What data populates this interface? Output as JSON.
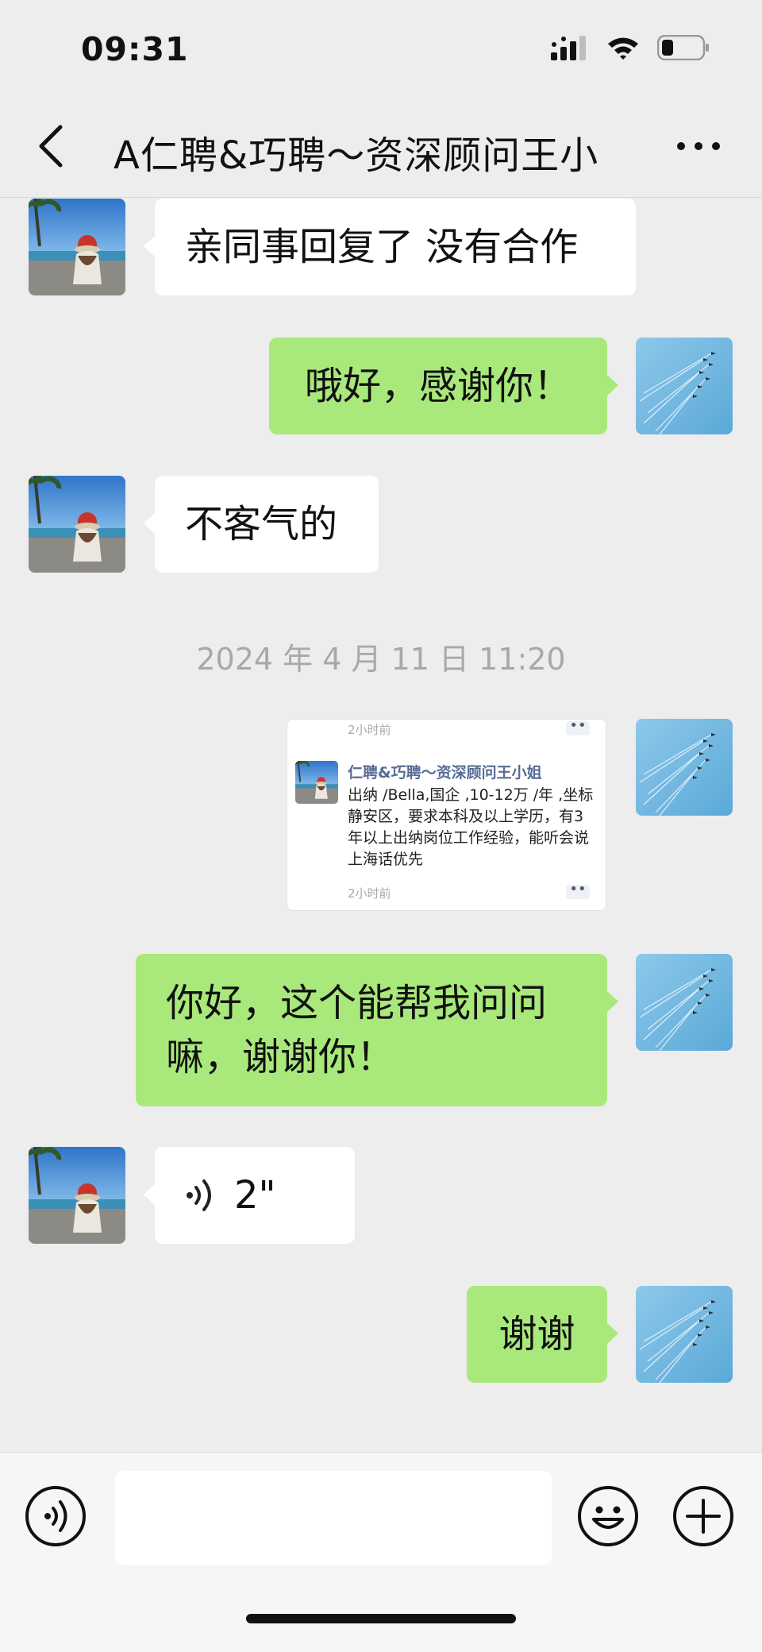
{
  "status_bar": {
    "time": "09:31"
  },
  "header": {
    "title": "A仁聘&巧聘～资深顾问王小"
  },
  "messages": {
    "m1": "亲同事回复了 没有合作",
    "m2": "哦好，感谢你！",
    "m3": "不客气的",
    "timestamp": "2024 年 4 月 11 日 11:20",
    "card": {
      "time_top": "2小时前",
      "name": "仁聘&巧聘～资深顾问王小姐",
      "text": "出纳 /Bella,国企 ,10-12万 /年 ,坐标静安区，要求本科及以上学历，有3年以上出纳岗位工作经验，能听会说上海话优先",
      "time_bottom": "2小时前",
      "dots": "••"
    },
    "m5": "你好，这个能帮我问问嘛，谢谢你！",
    "voice_duration": "2\"",
    "m7": "谢谢"
  },
  "colors": {
    "self_bubble": "#a9e97b",
    "other_bubble": "#ffffff",
    "background": "#ededed"
  }
}
